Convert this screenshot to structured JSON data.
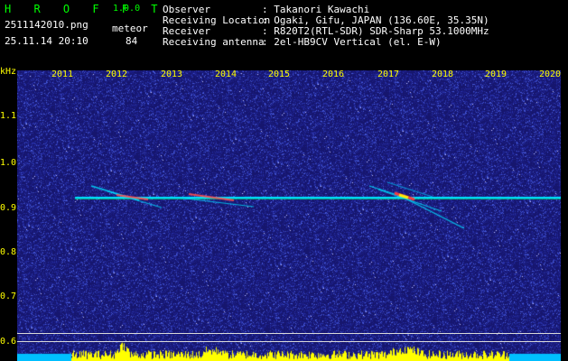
{
  "header": {
    "app_title": "H R O F F T",
    "version": "1.0.0",
    "filename": "2511142010.png",
    "mode": "meteor",
    "datetime": "25.11.14 20:10",
    "count": "84",
    "info": [
      {
        "label": "Observer",
        "value": ": Takanori Kawachi"
      },
      {
        "label": "Receiving Location",
        "value": ": Ogaki, Gifu, JAPAN (136.60E, 35.35N)"
      },
      {
        "label": "Receiver",
        "value": ": R820T2(RTL-SDR) SDR-Sharp 53.1000MHz"
      },
      {
        "label": "Receiving antenna",
        "value": ": 2el-HB9CV Vertical (el. E-W)"
      }
    ]
  },
  "y_axis": {
    "unit": "kHz",
    "ticks": [
      "1.1",
      "1.0",
      "0.9",
      "0.8",
      "0.7",
      "0.6"
    ]
  },
  "x_axis": {
    "ticks": [
      "2011",
      "2012",
      "2013",
      "2014",
      "2015",
      "2016",
      "2017",
      "2018",
      "2019",
      "2020"
    ]
  },
  "colors": {
    "background": "#1a1a78",
    "carrier": "#00e0ff",
    "echo_hot": "#ff3030",
    "bottom_bars": "#ffff00",
    "bottom_band": "#00bfff",
    "label": "#ffff00",
    "header_text": "#ffffff",
    "title": "#00ff00"
  }
}
